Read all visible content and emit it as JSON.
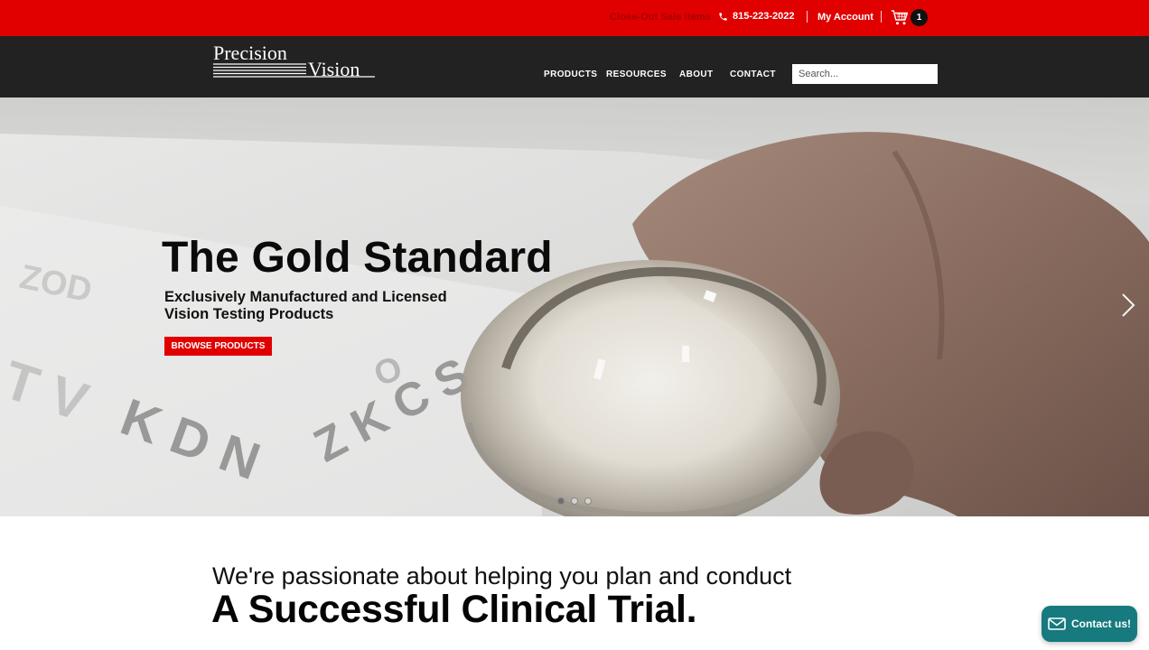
{
  "topbar": {
    "sale_link": "Close-Out Sale Items",
    "phone": "815-223-2022",
    "account": "My Account",
    "cart_count": "1"
  },
  "nav": {
    "logo_line1": "Precision",
    "logo_line2": "Vision",
    "items": [
      {
        "label": "PRODUCTS"
      },
      {
        "label": "RESOURCES"
      },
      {
        "label": "ABOUT"
      },
      {
        "label": "CONTACT"
      }
    ],
    "search_placeholder": "Search..."
  },
  "hero": {
    "title": "The Gold Standard",
    "subtitle_line1": "Exclusively Manufactured and Licensed",
    "subtitle_line2": "Vision Testing Products",
    "button": "BROWSE PRODUCTS",
    "slide_count": 3,
    "active_slide": 1
  },
  "intro": {
    "line": "We're passionate about helping you plan and conduct",
    "headline": "A Successful Clinical Trial."
  },
  "contact_widget": {
    "label": "Contact us!"
  },
  "icons": [
    "phone-icon",
    "cart-icon",
    "chevron-right-icon",
    "envelope-icon"
  ],
  "colors": {
    "brand_red": "#e00000",
    "nav_dark": "#222222",
    "contact_teal": "#167a7e"
  }
}
